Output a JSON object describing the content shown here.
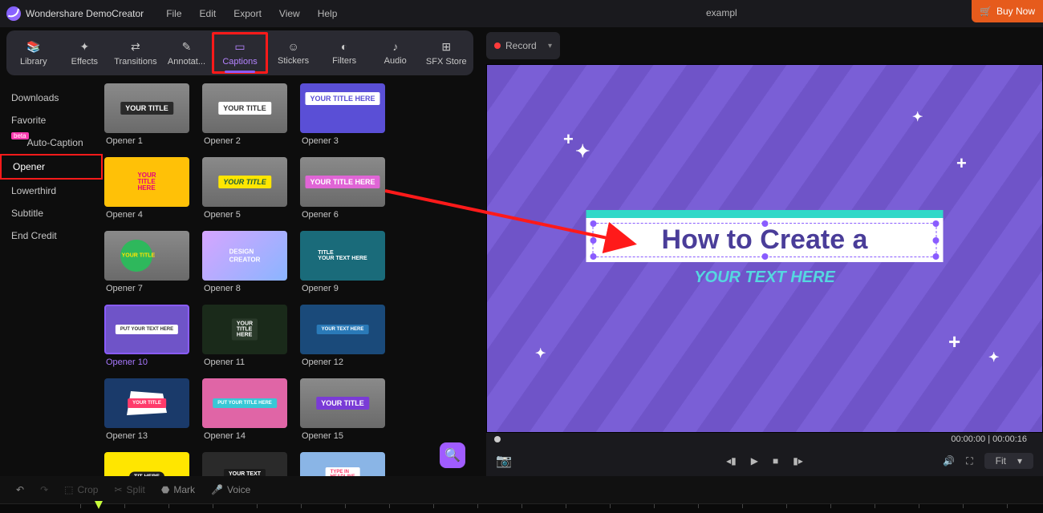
{
  "app": {
    "title": "Wondershare DemoCreator",
    "doc": "exampl",
    "buy": "Buy Now"
  },
  "menu": [
    "File",
    "Edit",
    "Export",
    "View",
    "Help"
  ],
  "tabs": [
    {
      "label": "Library",
      "icon": "library-icon"
    },
    {
      "label": "Effects",
      "icon": "effects-icon"
    },
    {
      "label": "Transitions",
      "icon": "transitions-icon"
    },
    {
      "label": "Annotat...",
      "icon": "annotations-icon"
    },
    {
      "label": "Captions",
      "icon": "captions-icon",
      "active": true,
      "boxed": true
    },
    {
      "label": "Stickers",
      "icon": "stickers-icon"
    },
    {
      "label": "Filters",
      "icon": "filters-icon"
    },
    {
      "label": "Audio",
      "icon": "audio-icon"
    },
    {
      "label": "SFX Store",
      "icon": "sfx-icon"
    }
  ],
  "categories": [
    {
      "label": "Downloads"
    },
    {
      "label": "Favorite"
    },
    {
      "label": "Auto-Caption",
      "badge": true
    },
    {
      "label": "Opener",
      "selected": true
    },
    {
      "label": "Lowerthird"
    },
    {
      "label": "Subtitle"
    },
    {
      "label": "End Credit"
    }
  ],
  "templates": [
    {
      "label": "Opener 1"
    },
    {
      "label": "Opener 2"
    },
    {
      "label": "Opener 3"
    },
    {
      "label": "Opener 4"
    },
    {
      "label": "Opener 5"
    },
    {
      "label": "Opener 6"
    },
    {
      "label": "Opener 7"
    },
    {
      "label": "Opener 8"
    },
    {
      "label": "Opener 9"
    },
    {
      "label": "Opener 10",
      "selected": true
    },
    {
      "label": "Opener 11"
    },
    {
      "label": "Opener 12"
    },
    {
      "label": "Opener 13"
    },
    {
      "label": "Opener 14"
    },
    {
      "label": "Opener 15"
    },
    {
      "label": ""
    },
    {
      "label": ""
    },
    {
      "label": ""
    }
  ],
  "record": "Record",
  "preview": {
    "title": "How to Create a",
    "subtitle": "YOUR TEXT HERE"
  },
  "time": {
    "current": "00:00:00",
    "total": "00:00:16"
  },
  "fit": "Fit",
  "tools": {
    "crop": "Crop",
    "split": "Split",
    "mark": "Mark",
    "voice": "Voice"
  }
}
